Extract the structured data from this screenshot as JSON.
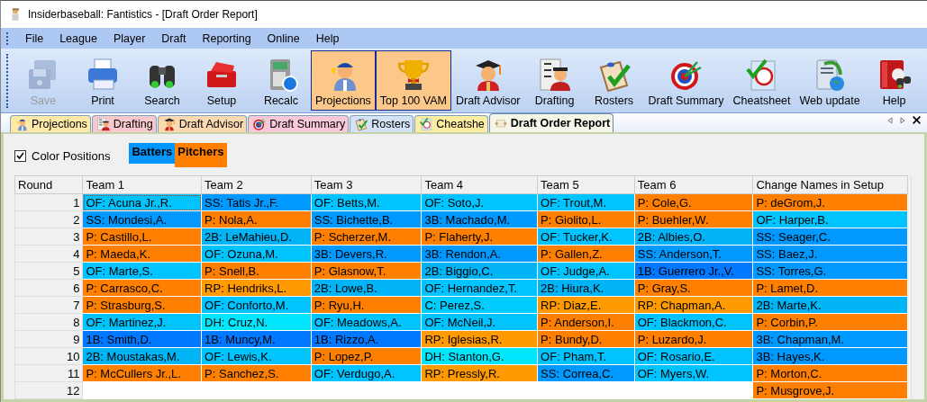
{
  "window": {
    "title": "Insiderbaseball: Fantistics - [Draft Order Report]"
  },
  "menu": [
    "File",
    "League",
    "Player",
    "Draft",
    "Reporting",
    "Online",
    "Help"
  ],
  "toolbar": [
    {
      "label": "Save",
      "disabled": true,
      "highlighted": false
    },
    {
      "label": "Print",
      "disabled": false,
      "highlighted": false
    },
    {
      "label": "Search",
      "disabled": false,
      "highlighted": false
    },
    {
      "label": "Setup",
      "disabled": false,
      "highlighted": false
    },
    {
      "label": "Recalc",
      "disabled": false,
      "highlighted": false
    },
    {
      "label": "Projections",
      "disabled": false,
      "highlighted": true
    },
    {
      "label": "Top 100 VAM",
      "disabled": false,
      "highlighted": true
    },
    {
      "label": "Draft Advisor",
      "disabled": false,
      "highlighted": false
    },
    {
      "label": "Drafting",
      "disabled": false,
      "highlighted": false
    },
    {
      "label": "Rosters",
      "disabled": false,
      "highlighted": false
    },
    {
      "label": "Draft Summary",
      "disabled": false,
      "highlighted": false
    },
    {
      "label": "Cheatsheet",
      "disabled": false,
      "highlighted": false
    },
    {
      "label": "Web update",
      "disabled": false,
      "highlighted": false
    },
    {
      "label": "Help",
      "disabled": false,
      "highlighted": false
    }
  ],
  "tabs": [
    {
      "label": "Projections",
      "selected": false,
      "color": "#fde9a8"
    },
    {
      "label": "Drafting",
      "selected": false,
      "color": "#f8c8cc"
    },
    {
      "label": "Draft Advisor",
      "selected": false,
      "color": "#fbd9b0"
    },
    {
      "label": "Draft Summary",
      "selected": false,
      "color": "#f8c8d8"
    },
    {
      "label": "Rosters",
      "selected": false,
      "color": "#d4e2f6"
    },
    {
      "label": "Cheatshe",
      "selected": false,
      "color": "#fdeda0"
    },
    {
      "label": "Draft Order Report",
      "selected": true,
      "color": "#f4f7e8"
    }
  ],
  "options": {
    "color_positions": {
      "label": "Color Positions",
      "checked": true
    }
  },
  "legend": [
    {
      "label": "Batters",
      "color": "#0096ff"
    },
    {
      "label": "Pitchers",
      "color": "#ff8000"
    }
  ],
  "table": {
    "columns": [
      "Round",
      "Team 1",
      "Team 2",
      "Team 3",
      "Team 4",
      "Team 5",
      "Team 6",
      "Change Names in Setup"
    ],
    "rows": [
      [
        {
          "text": "1"
        },
        {
          "text": "OF: Acuna Jr.,R.",
          "color": "#00c4ff"
        },
        {
          "text": "SS: Tatis Jr.,F.",
          "color": "#0099ff"
        },
        {
          "text": "OF: Betts,M.",
          "color": "#00c4ff"
        },
        {
          "text": "OF: Soto,J.",
          "color": "#00c4ff"
        },
        {
          "text": "OF: Trout,M.",
          "color": "#00c4ff"
        },
        {
          "text": "P: Cole,G.",
          "color": "#ff8000"
        },
        {
          "text": "P: deGrom,J.",
          "color": "#ff8000"
        }
      ],
      [
        {
          "text": "2"
        },
        {
          "text": "SS: Mondesi,A.",
          "color": "#0099ff"
        },
        {
          "text": "P: Nola,A.",
          "color": "#ff8000"
        },
        {
          "text": "SS: Bichette,B.",
          "color": "#0099ff"
        },
        {
          "text": "3B: Machado,M.",
          "color": "#0099ff"
        },
        {
          "text": "P: Giolito,L.",
          "color": "#ff8000"
        },
        {
          "text": "P: Buehler,W.",
          "color": "#ff8000"
        },
        {
          "text": "OF: Harper,B.",
          "color": "#00c4ff"
        }
      ],
      [
        {
          "text": "3"
        },
        {
          "text": "P: Castillo,L.",
          "color": "#ff8000"
        },
        {
          "text": "2B: LeMahieu,D.",
          "color": "#00b4f5"
        },
        {
          "text": "P: Scherzer,M.",
          "color": "#ff8000"
        },
        {
          "text": "P: Flaherty,J.",
          "color": "#ff8000"
        },
        {
          "text": "OF: Tucker,K.",
          "color": "#00c4ff"
        },
        {
          "text": "2B: Albies,O.",
          "color": "#00b4f5"
        },
        {
          "text": "SS: Seager,C.",
          "color": "#0099ff"
        }
      ],
      [
        {
          "text": "4"
        },
        {
          "text": "P: Maeda,K.",
          "color": "#ff8000"
        },
        {
          "text": "OF: Ozuna,M.",
          "color": "#00c4ff"
        },
        {
          "text": "3B: Devers,R.",
          "color": "#0099ff"
        },
        {
          "text": "3B: Rendon,A.",
          "color": "#0099ff"
        },
        {
          "text": "P: Gallen,Z.",
          "color": "#ff8000"
        },
        {
          "text": "SS: Anderson,T.",
          "color": "#0099ff"
        },
        {
          "text": "SS: Baez,J.",
          "color": "#0099ff"
        }
      ],
      [
        {
          "text": "5"
        },
        {
          "text": "OF: Marte,S.",
          "color": "#00c4ff"
        },
        {
          "text": "P: Snell,B.",
          "color": "#ff8000"
        },
        {
          "text": "P: Glasnow,T.",
          "color": "#ff8000"
        },
        {
          "text": "2B: Biggio,C.",
          "color": "#00b4f5"
        },
        {
          "text": "OF: Judge,A.",
          "color": "#00c4ff"
        },
        {
          "text": "1B: Guerrero Jr.,V.",
          "color": "#0078ff"
        },
        {
          "text": "SS: Torres,G.",
          "color": "#0099ff"
        }
      ],
      [
        {
          "text": "6"
        },
        {
          "text": "P: Carrasco,C.",
          "color": "#ff8000"
        },
        {
          "text": "RP: Hendriks,L.",
          "color": "#ff9a00"
        },
        {
          "text": "2B: Lowe,B.",
          "color": "#00b4f5"
        },
        {
          "text": "OF: Hernandez,T.",
          "color": "#00c4ff"
        },
        {
          "text": "2B: Hiura,K.",
          "color": "#00b4f5"
        },
        {
          "text": "P: Gray,S.",
          "color": "#ff8000"
        },
        {
          "text": "P: Lamet,D.",
          "color": "#ff8000"
        }
      ],
      [
        {
          "text": "7"
        },
        {
          "text": "P: Strasburg,S.",
          "color": "#ff8000"
        },
        {
          "text": "OF: Conforto,M.",
          "color": "#00c4ff"
        },
        {
          "text": "P: Ryu,H.",
          "color": "#ff8000"
        },
        {
          "text": "C: Perez,S.",
          "color": "#00ccff"
        },
        {
          "text": "RP: Diaz,E.",
          "color": "#ff9a00"
        },
        {
          "text": "RP: Chapman,A.",
          "color": "#ff9a00"
        },
        {
          "text": "2B: Marte,K.",
          "color": "#00b4f5"
        }
      ],
      [
        {
          "text": "8"
        },
        {
          "text": "OF: Martinez,J.",
          "color": "#00c4ff"
        },
        {
          "text": "DH: Cruz,N.",
          "color": "#00e6ff"
        },
        {
          "text": "OF: Meadows,A.",
          "color": "#00c4ff"
        },
        {
          "text": "OF: McNeil,J.",
          "color": "#00c4ff"
        },
        {
          "text": "P: Anderson,I.",
          "color": "#ff8000"
        },
        {
          "text": "OF: Blackmon,C.",
          "color": "#00c4ff"
        },
        {
          "text": "P: Corbin,P.",
          "color": "#ff8000"
        }
      ],
      [
        {
          "text": "9"
        },
        {
          "text": "1B: Smith,D.",
          "color": "#0078ff"
        },
        {
          "text": "1B: Muncy,M.",
          "color": "#0078ff"
        },
        {
          "text": "1B: Rizzo,A.",
          "color": "#0078ff"
        },
        {
          "text": "RP: Iglesias,R.",
          "color": "#ff9a00"
        },
        {
          "text": "P: Bundy,D.",
          "color": "#ff8000"
        },
        {
          "text": "P: Luzardo,J.",
          "color": "#ff8000"
        },
        {
          "text": "3B: Chapman,M.",
          "color": "#0099ff"
        }
      ],
      [
        {
          "text": "10"
        },
        {
          "text": "2B: Moustakas,M.",
          "color": "#00b4f5"
        },
        {
          "text": "OF: Lewis,K.",
          "color": "#00c4ff"
        },
        {
          "text": "P: Lopez,P.",
          "color": "#ff8000"
        },
        {
          "text": "DH: Stanton,G.",
          "color": "#00e6ff"
        },
        {
          "text": "OF: Pham,T.",
          "color": "#00c4ff"
        },
        {
          "text": "OF: Rosario,E.",
          "color": "#00c4ff"
        },
        {
          "text": "3B: Hayes,K.",
          "color": "#0099ff"
        }
      ],
      [
        {
          "text": "11"
        },
        {
          "text": "P: McCullers Jr.,L.",
          "color": "#ff8000"
        },
        {
          "text": "P: Sanchez,S.",
          "color": "#ff8000"
        },
        {
          "text": "OF: Verdugo,A.",
          "color": "#00c4ff"
        },
        {
          "text": "RP: Pressly,R.",
          "color": "#ff9a00"
        },
        {
          "text": "SS: Correa,C.",
          "color": "#0099ff"
        },
        {
          "text": "OF: Myers,W.",
          "color": "#00c4ff"
        },
        {
          "text": "P: Morton,C.",
          "color": "#ff8000"
        }
      ],
      [
        {
          "text": "12"
        },
        {
          "text": ""
        },
        {
          "text": ""
        },
        {
          "text": ""
        },
        {
          "text": ""
        },
        {
          "text": ""
        },
        {
          "text": ""
        },
        {
          "text": "P: Musgrove,J.",
          "color": "#ff8000"
        }
      ]
    ]
  }
}
